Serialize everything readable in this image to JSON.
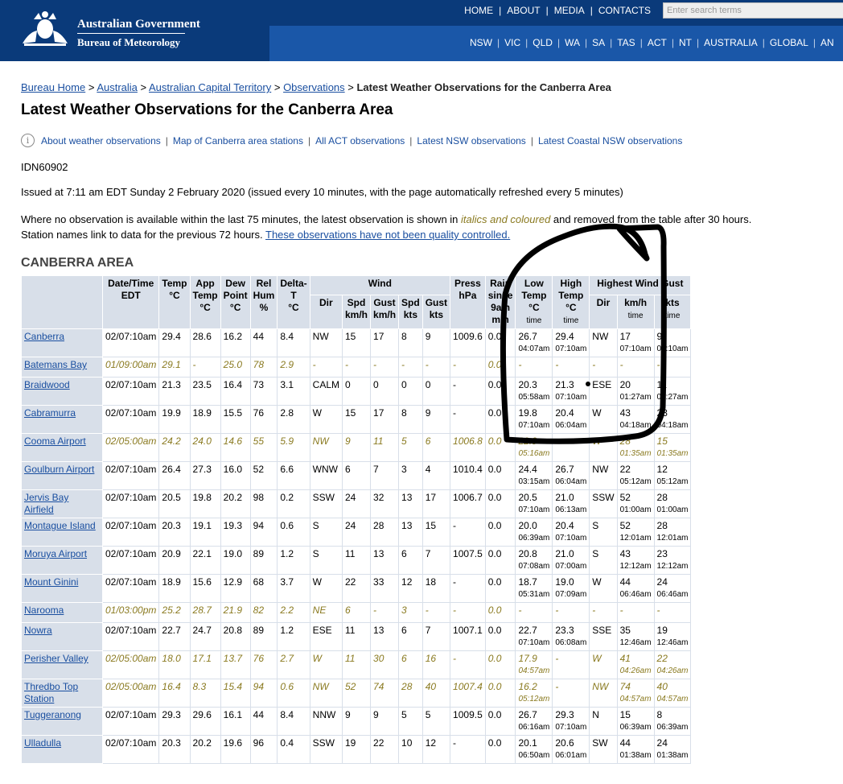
{
  "header": {
    "gov_title": "Australian Government",
    "gov_sub": "Bureau of Meteorology",
    "top_nav": [
      "HOME",
      "ABOUT",
      "MEDIA",
      "CONTACTS"
    ],
    "search_placeholder": "Enter search terms",
    "state_nav": [
      "NSW",
      "VIC",
      "QLD",
      "WA",
      "SA",
      "TAS",
      "ACT",
      "NT",
      "AUSTRALIA",
      "GLOBAL",
      "AN"
    ]
  },
  "breadcrumb": {
    "items": [
      "Bureau Home",
      "Australia",
      "Australian Capital Territory",
      "Observations"
    ],
    "current": "Latest Weather Observations for the Canberra Area"
  },
  "page_title": "Latest Weather Observations for the Canberra Area",
  "links": [
    "About weather observations",
    "Map of Canberra area stations",
    "All ACT observations",
    "Latest NSW observations",
    "Latest Coastal NSW observations"
  ],
  "idn": "IDN60902",
  "issued": "Issued at 7:11 am EDT Sunday 2 February 2020 (issued every 10 minutes, with the page automatically refreshed every 5 minutes)",
  "note": {
    "line1_start": "Where no observation is available within the last 75 minutes, the latest observation is shown in ",
    "line1_italic": "italics and coloured",
    "line1_end": " and removed from the table after 30 hours.",
    "line2_start": "Station names link to data for the previous 72 hours. ",
    "line2_link": "These observations have not been quality controlled."
  },
  "section_title": "CANBERRA AREA",
  "table": {
    "headers": {
      "datetime": [
        "Date/Time",
        "EDT"
      ],
      "temp": [
        "Temp",
        "°C"
      ],
      "app_temp": [
        "App",
        "Temp",
        "°C"
      ],
      "dew_point": [
        "Dew",
        "Point",
        "°C"
      ],
      "rel_hum": [
        "Rel",
        "Hum",
        "%"
      ],
      "delta_t": [
        "Delta-",
        "T",
        "°C"
      ],
      "wind": "Wind",
      "dir": "Dir",
      "spd_kmh": [
        "Spd",
        "km/h"
      ],
      "gust_kmh": [
        "Gust",
        "km/h"
      ],
      "spd_kts": [
        "Spd",
        "kts"
      ],
      "gust_kts": [
        "Gust",
        "kts"
      ],
      "press": [
        "Press",
        "hPa"
      ],
      "rain": [
        "Rain",
        "since",
        "9am",
        "mm"
      ],
      "low_temp": [
        "Low",
        "Temp",
        "°C",
        "time"
      ],
      "high_temp": [
        "High",
        "Temp",
        "°C",
        "time"
      ],
      "highest_gust": "Highest Wind Gust",
      "hg_dir": "Dir",
      "hg_kmh": [
        "km/h",
        "time"
      ],
      "hg_kts": [
        "kts",
        "time"
      ]
    },
    "rows": [
      {
        "station": "Canberra",
        "old": false,
        "dt": "02/07:10am",
        "temp": "29.4",
        "app": "28.6",
        "dew": "16.2",
        "rh": "44",
        "dt_t": "8.4",
        "dir": "NW",
        "spd": "15",
        "gust": "17",
        "spdk": "8",
        "gustk": "9",
        "press": "1009.6",
        "rain": "0.0",
        "low": "26.7",
        "low_t": "04:07am",
        "high": "29.4",
        "high_t": "07:10am",
        "hgdir": "NW",
        "hgkmh": "17",
        "hgkmh_t": "07:10am",
        "hgkts": "9",
        "hgkts_t": "07:10am"
      },
      {
        "station": "Batemans Bay",
        "old": true,
        "dt": "01/09:00am",
        "temp": "29.1",
        "app": "-",
        "dew": "25.0",
        "rh": "78",
        "dt_t": "2.9",
        "dir": "-",
        "spd": "-",
        "gust": "-",
        "spdk": "-",
        "gustk": "-",
        "press": "-",
        "rain": "0.0",
        "low": "-",
        "low_t": "",
        "high": "-",
        "high_t": "",
        "hgdir": "-",
        "hgkmh": "-",
        "hgkmh_t": "",
        "hgkts": "-",
        "hgkts_t": ""
      },
      {
        "station": "Braidwood",
        "old": false,
        "dt": "02/07:10am",
        "temp": "21.3",
        "app": "23.5",
        "dew": "16.4",
        "rh": "73",
        "dt_t": "3.1",
        "dir": "CALM",
        "spd": "0",
        "gust": "0",
        "spdk": "0",
        "gustk": "0",
        "press": "-",
        "rain": "0.0",
        "low": "20.3",
        "low_t": "05:58am",
        "high": "21.3",
        "high_t": "07:10am",
        "hgdir": "ESE",
        "hgkmh": "20",
        "hgkmh_t": "01:27am",
        "hgkts": "11",
        "hgkts_t": "01:27am"
      },
      {
        "station": "Cabramurra",
        "old": false,
        "dt": "02/07:10am",
        "temp": "19.9",
        "app": "18.9",
        "dew": "15.5",
        "rh": "76",
        "dt_t": "2.8",
        "dir": "W",
        "spd": "15",
        "gust": "17",
        "spdk": "8",
        "gustk": "9",
        "press": "-",
        "rain": "0.0",
        "low": "19.8",
        "low_t": "07:10am",
        "high": "20.4",
        "high_t": "06:04am",
        "hgdir": "W",
        "hgkmh": "43",
        "hgkmh_t": "04:18am",
        "hgkts": "23",
        "hgkts_t": "04:18am"
      },
      {
        "station": "Cooma Airport",
        "old": true,
        "dt": "02/05:00am",
        "temp": "24.2",
        "app": "24.0",
        "dew": "14.6",
        "rh": "55",
        "dt_t": "5.9",
        "dir": "NW",
        "spd": "9",
        "gust": "11",
        "spdk": "5",
        "gustk": "6",
        "press": "1006.8",
        "rain": "0.0",
        "low": "22.9",
        "low_t": "05:16am",
        "high": "",
        "high_t": "",
        "hgdir": "W",
        "hgkmh": "28",
        "hgkmh_t": "01:35am",
        "hgkts": "15",
        "hgkts_t": "01:35am"
      },
      {
        "station": "Goulburn Airport",
        "old": false,
        "dt": "02/07:10am",
        "temp": "26.4",
        "app": "27.3",
        "dew": "16.0",
        "rh": "52",
        "dt_t": "6.6",
        "dir": "WNW",
        "spd": "6",
        "gust": "7",
        "spdk": "3",
        "gustk": "4",
        "press": "1010.4",
        "rain": "0.0",
        "low": "24.4",
        "low_t": "03:15am",
        "high": "26.7",
        "high_t": "06:04am",
        "hgdir": "NW",
        "hgkmh": "22",
        "hgkmh_t": "05:12am",
        "hgkts": "12",
        "hgkts_t": "05:12am"
      },
      {
        "station": "Jervis Bay Airfield",
        "old": false,
        "dt": "02/07:10am",
        "temp": "20.5",
        "app": "19.8",
        "dew": "20.2",
        "rh": "98",
        "dt_t": "0.2",
        "dir": "SSW",
        "spd": "24",
        "gust": "32",
        "spdk": "13",
        "gustk": "17",
        "press": "1006.7",
        "rain": "0.0",
        "low": "20.5",
        "low_t": "07:10am",
        "high": "21.0",
        "high_t": "06:13am",
        "hgdir": "SSW",
        "hgkmh": "52",
        "hgkmh_t": "01:00am",
        "hgkts": "28",
        "hgkts_t": "01:00am"
      },
      {
        "station": "Montague Island",
        "old": false,
        "dt": "02/07:10am",
        "temp": "20.3",
        "app": "19.1",
        "dew": "19.3",
        "rh": "94",
        "dt_t": "0.6",
        "dir": "S",
        "spd": "24",
        "gust": "28",
        "spdk": "13",
        "gustk": "15",
        "press": "-",
        "rain": "0.0",
        "low": "20.0",
        "low_t": "06:39am",
        "high": "20.4",
        "high_t": "07:10am",
        "hgdir": "S",
        "hgkmh": "52",
        "hgkmh_t": "12:01am",
        "hgkts": "28",
        "hgkts_t": "12:01am"
      },
      {
        "station": "Moruya Airport",
        "old": false,
        "dt": "02/07:10am",
        "temp": "20.9",
        "app": "22.1",
        "dew": "19.0",
        "rh": "89",
        "dt_t": "1.2",
        "dir": "S",
        "spd": "11",
        "gust": "13",
        "spdk": "6",
        "gustk": "7",
        "press": "1007.5",
        "rain": "0.0",
        "low": "20.8",
        "low_t": "07:08am",
        "high": "21.0",
        "high_t": "07:00am",
        "hgdir": "S",
        "hgkmh": "43",
        "hgkmh_t": "12:12am",
        "hgkts": "23",
        "hgkts_t": "12:12am"
      },
      {
        "station": "Mount Ginini",
        "old": false,
        "dt": "02/07:10am",
        "temp": "18.9",
        "app": "15.6",
        "dew": "12.9",
        "rh": "68",
        "dt_t": "3.7",
        "dir": "W",
        "spd": "22",
        "gust": "33",
        "spdk": "12",
        "gustk": "18",
        "press": "-",
        "rain": "0.0",
        "low": "18.7",
        "low_t": "05:31am",
        "high": "19.0",
        "high_t": "07:09am",
        "hgdir": "W",
        "hgkmh": "44",
        "hgkmh_t": "06:46am",
        "hgkts": "24",
        "hgkts_t": "06:46am"
      },
      {
        "station": "Narooma",
        "old": true,
        "dt": "01/03:00pm",
        "temp": "25.2",
        "app": "28.7",
        "dew": "21.9",
        "rh": "82",
        "dt_t": "2.2",
        "dir": "NE",
        "spd": "6",
        "gust": "-",
        "spdk": "3",
        "gustk": "-",
        "press": "-",
        "rain": "0.0",
        "low": "-",
        "low_t": "",
        "high": "-",
        "high_t": "",
        "hgdir": "-",
        "hgkmh": "-",
        "hgkmh_t": "",
        "hgkts": "-",
        "hgkts_t": ""
      },
      {
        "station": "Nowra",
        "old": false,
        "dt": "02/07:10am",
        "temp": "22.7",
        "app": "24.7",
        "dew": "20.8",
        "rh": "89",
        "dt_t": "1.2",
        "dir": "ESE",
        "spd": "11",
        "gust": "13",
        "spdk": "6",
        "gustk": "7",
        "press": "1007.1",
        "rain": "0.0",
        "low": "22.7",
        "low_t": "07:10am",
        "high": "23.3",
        "high_t": "06:08am",
        "hgdir": "SSE",
        "hgkmh": "35",
        "hgkmh_t": "12:46am",
        "hgkts": "19",
        "hgkts_t": "12:46am"
      },
      {
        "station": "Perisher Valley",
        "old": true,
        "dt": "02/05:00am",
        "temp": "18.0",
        "app": "17.1",
        "dew": "13.7",
        "rh": "76",
        "dt_t": "2.7",
        "dir": "W",
        "spd": "11",
        "gust": "30",
        "spdk": "6",
        "gustk": "16",
        "press": "-",
        "rain": "0.0",
        "low": "17.9",
        "low_t": "04:57am",
        "high": "-",
        "high_t": "",
        "hgdir": "W",
        "hgkmh": "41",
        "hgkmh_t": "04:26am",
        "hgkts": "22",
        "hgkts_t": "04:26am"
      },
      {
        "station": "Thredbo Top Station",
        "old": true,
        "dt": "02/05:00am",
        "temp": "16.4",
        "app": "8.3",
        "dew": "15.4",
        "rh": "94",
        "dt_t": "0.6",
        "dir": "NW",
        "spd": "52",
        "gust": "74",
        "spdk": "28",
        "gustk": "40",
        "press": "1007.4",
        "rain": "0.0",
        "low": "16.2",
        "low_t": "05:12am",
        "high": "-",
        "high_t": "",
        "hgdir": "NW",
        "hgkmh": "74",
        "hgkmh_t": "04:57am",
        "hgkts": "40",
        "hgkts_t": "04:57am"
      },
      {
        "station": "Tuggeranong",
        "old": false,
        "dt": "02/07:10am",
        "temp": "29.3",
        "app": "29.6",
        "dew": "16.1",
        "rh": "44",
        "dt_t": "8.4",
        "dir": "NNW",
        "spd": "9",
        "gust": "9",
        "spdk": "5",
        "gustk": "5",
        "press": "1009.5",
        "rain": "0.0",
        "low": "26.7",
        "low_t": "06:16am",
        "high": "29.3",
        "high_t": "07:10am",
        "hgdir": "N",
        "hgkmh": "15",
        "hgkmh_t": "06:39am",
        "hgkts": "8",
        "hgkts_t": "06:39am"
      },
      {
        "station": "Ulladulla",
        "old": false,
        "dt": "02/07:10am",
        "temp": "20.3",
        "app": "20.2",
        "dew": "19.6",
        "rh": "96",
        "dt_t": "0.4",
        "dir": "SSW",
        "spd": "19",
        "gust": "22",
        "spdk": "10",
        "gustk": "12",
        "press": "-",
        "rain": "0.0",
        "low": "20.1",
        "low_t": "06:50am",
        "high": "20.6",
        "high_t": "06:01am",
        "hgdir": "SW",
        "hgkmh": "44",
        "hgkmh_t": "01:38am",
        "hgkts": "24",
        "hgkts_t": "01:38am"
      }
    ]
  },
  "colors": {
    "header_dark": "#0a3a7a",
    "header_bar": "#1a57a8",
    "link": "#1a4fa0",
    "old_obs": "#8a7a20",
    "table_header_bg": "#d8dfe9"
  }
}
